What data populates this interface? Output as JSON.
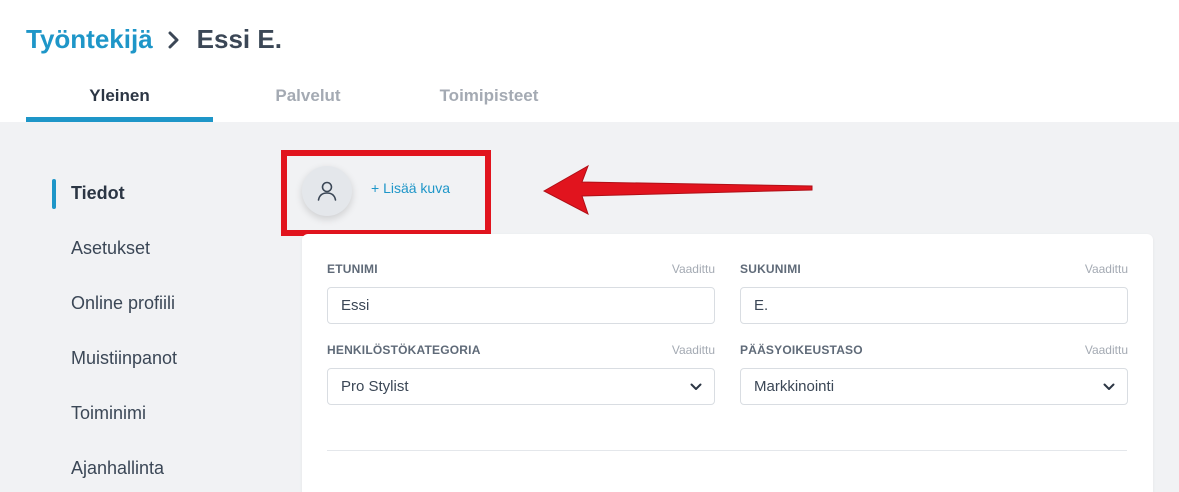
{
  "breadcrumb": {
    "parent": "Työntekijä",
    "current": "Essi E."
  },
  "tabs": [
    {
      "label": "Yleinen",
      "active": true
    },
    {
      "label": "Palvelut",
      "active": false
    },
    {
      "label": "Toimipisteet",
      "active": false
    }
  ],
  "sidenav": {
    "items": [
      {
        "label": "Tiedot",
        "active": true
      },
      {
        "label": "Asetukset",
        "active": false
      },
      {
        "label": "Online profiili",
        "active": false
      },
      {
        "label": "Muistiinpanot",
        "active": false
      },
      {
        "label": "Toiminimi",
        "active": false
      },
      {
        "label": "Ajanhallinta",
        "active": false
      }
    ]
  },
  "photo": {
    "add_label": "+ Lisää kuva",
    "icon": "user-icon"
  },
  "form": {
    "first_name": {
      "label": "ETUNIMI",
      "required": "Vaadittu",
      "value": "Essi"
    },
    "last_name": {
      "label": "SUKUNIMI",
      "required": "Vaadittu",
      "value": "E."
    },
    "staff_category": {
      "label": "HENKILÖSTÖKATEGORIA",
      "required": "Vaadittu",
      "value": "Pro Stylist"
    },
    "access_level": {
      "label": "PÄÄSYOIKEUSTASO",
      "required": "Vaadittu",
      "value": "Markkinointi"
    }
  },
  "colors": {
    "accent": "#1e96c8",
    "annotation": "#e1141e",
    "background": "#f1f2f4",
    "text": "#3b4756"
  }
}
